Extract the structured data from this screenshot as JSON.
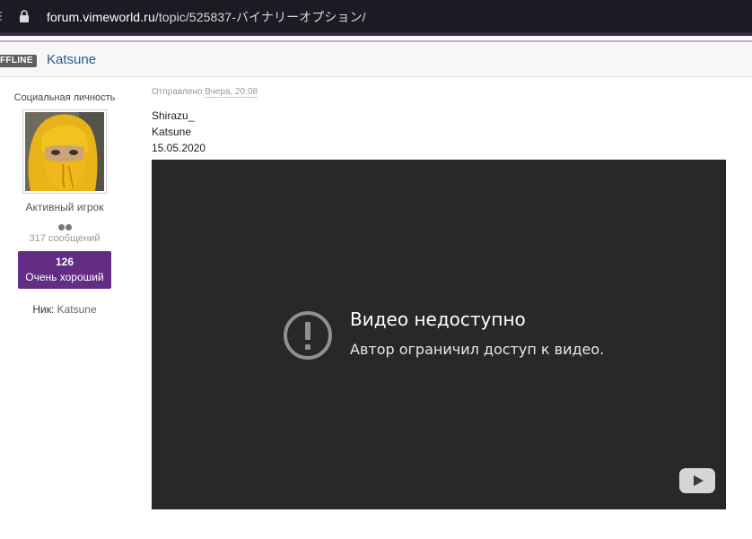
{
  "browser": {
    "url_host": "forum.vimeworld.ru",
    "url_path": "/topic/525837-バイナリーオプション/"
  },
  "author_bar": {
    "status": "FFLINE",
    "name": "Katsune"
  },
  "profile": {
    "title": "Социальная личность",
    "rank": "Активный игрок",
    "posts": "317 сообщений",
    "reputation_value": "126",
    "reputation_label": "Очень хороший",
    "nick_label": "Ник:",
    "nick_value": "Katsune"
  },
  "post": {
    "meta_prefix": "Отправлено",
    "meta_time": "Вчера, 20:08",
    "lines": [
      "Shirazu_",
      "Katsune",
      "15.05.2020"
    ]
  },
  "video": {
    "error_title": "Видео недоступно",
    "error_message": "Автор ограничил доступ к видео."
  },
  "colors": {
    "reputation_bg": "#632c85",
    "author_name": "#2b5c86",
    "video_bg": "#282828"
  }
}
